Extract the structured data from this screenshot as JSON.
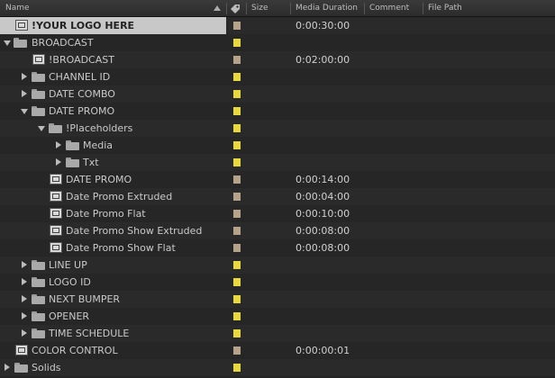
{
  "header": {
    "name": "Name",
    "size": "Size",
    "media_duration": "Media Duration",
    "comment": "Comment",
    "file_path": "File Path"
  },
  "colors": {
    "yellow_label": "#e6d83e",
    "tan_label": "#b5a28a"
  },
  "rows": [
    {
      "name": "!YOUR LOGO HERE",
      "type": "comp",
      "duration": "0:00:30:00",
      "label": "tan"
    },
    {
      "name": "BROADCAST",
      "type": "folder",
      "duration": "",
      "label": "yellow"
    },
    {
      "name": "!BROADCAST",
      "type": "comp",
      "duration": "0:02:00:00",
      "label": "tan"
    },
    {
      "name": "CHANNEL ID",
      "type": "folder",
      "duration": "",
      "label": "yellow"
    },
    {
      "name": "DATE COMBO",
      "type": "folder",
      "duration": "",
      "label": "yellow"
    },
    {
      "name": "DATE PROMO",
      "type": "folder",
      "duration": "",
      "label": "yellow"
    },
    {
      "name": "!Placeholders",
      "type": "folder",
      "duration": "",
      "label": "yellow"
    },
    {
      "name": "Media",
      "type": "folder",
      "duration": "",
      "label": "yellow"
    },
    {
      "name": "Txt",
      "type": "folder",
      "duration": "",
      "label": "yellow"
    },
    {
      "name": "DATE PROMO",
      "type": "comp",
      "duration": "0:00:14:00",
      "label": "tan"
    },
    {
      "name": "Date Promo Extruded",
      "type": "comp",
      "duration": "0:00:04:00",
      "label": "tan"
    },
    {
      "name": "Date Promo Flat",
      "type": "comp",
      "duration": "0:00:10:00",
      "label": "tan"
    },
    {
      "name": "Date Promo Show Extruded",
      "type": "comp",
      "duration": "0:00:08:00",
      "label": "tan"
    },
    {
      "name": "Date Promo Show Flat",
      "type": "comp",
      "duration": "0:00:08:00",
      "label": "tan"
    },
    {
      "name": "LINE UP",
      "type": "folder",
      "duration": "",
      "label": "yellow"
    },
    {
      "name": "LOGO ID",
      "type": "folder",
      "duration": "",
      "label": "yellow"
    },
    {
      "name": "NEXT BUMPER",
      "type": "folder",
      "duration": "",
      "label": "yellow"
    },
    {
      "name": "OPENER",
      "type": "folder",
      "duration": "",
      "label": "yellow"
    },
    {
      "name": "TIME SCHEDULE",
      "type": "folder",
      "duration": "",
      "label": "yellow"
    },
    {
      "name": "COLOR CONTROL",
      "type": "comp",
      "duration": "0:00:00:01",
      "label": "tan"
    },
    {
      "name": "Solids",
      "type": "folder",
      "duration": "",
      "label": "yellow"
    }
  ]
}
